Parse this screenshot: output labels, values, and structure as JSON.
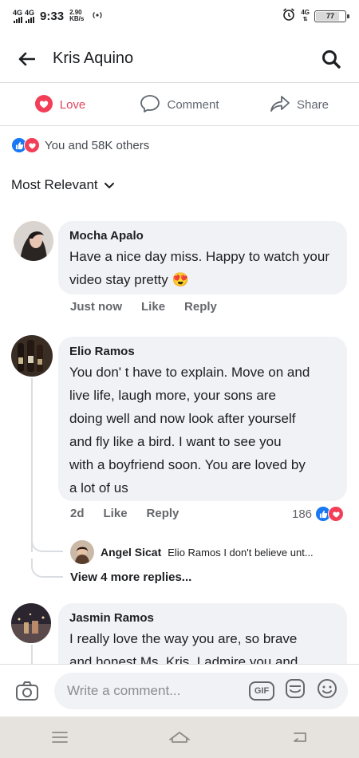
{
  "status_bar": {
    "network1": "4G",
    "network2": "4G",
    "time": "9:33",
    "speed_value": "2.90",
    "speed_unit": "KB/s",
    "net_right": "4G",
    "battery": "77"
  },
  "header": {
    "title": "Kris Aquino",
    "back_icon": "back-arrow-icon",
    "search_icon": "search-icon"
  },
  "actions": [
    {
      "label": "Love",
      "icon": "love-reaction-icon",
      "color": "#e0455e"
    },
    {
      "label": "Comment",
      "icon": "comment-icon"
    },
    {
      "label": "Share",
      "icon": "share-icon"
    }
  ],
  "reactions": {
    "text": "You and 58K others"
  },
  "sort": {
    "label": "Most Relevant"
  },
  "comments": [
    {
      "name": "Mocha Apalo",
      "text": "Have a nice day miss.  Happy to watch your video stay pretty",
      "emoji": "😍",
      "time": "Just now",
      "like": "Like",
      "reply": "Reply"
    },
    {
      "name": "Elio Ramos",
      "lines": [
        "You don' t have to explain.  Move on and",
        "live life,  laugh more,  your sons are",
        "doing well and now look after yourself",
        "and fly like a bird.  I want to see you",
        "with a boyfriend soon.  You are loved by",
        "a lot of us"
      ],
      "time": "2d",
      "like": "Like",
      "reply": "Reply",
      "reaction_count": "186",
      "reply_preview": {
        "name": "Angel Sicat",
        "text": "Elio Ramos I don't believe unt..."
      },
      "more_replies": "View 4 more replies..."
    },
    {
      "name": "Jasmin Ramos",
      "lines": [
        "I really love the way you are,  so brave",
        "and honest Ms.  Kris.   I admire you and"
      ]
    }
  ],
  "composer": {
    "placeholder": "Write a comment...",
    "gif_label": "GIF"
  },
  "colors": {
    "facebook_blue": "#1877f2",
    "love_red": "#f33e58",
    "bubble_bg": "#f0f2f5",
    "nav_bg": "#e6e2dd"
  }
}
